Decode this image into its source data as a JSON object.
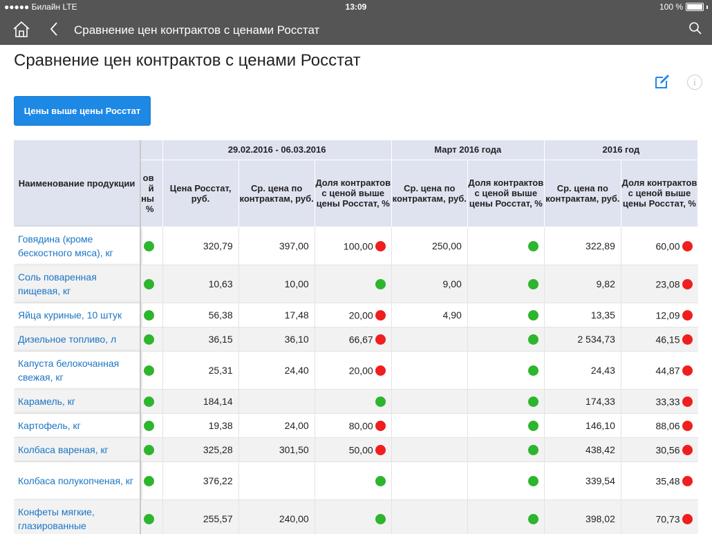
{
  "status": {
    "carrier": "●●●●● Билайн  LTE",
    "time": "13:09",
    "battery": "100 %"
  },
  "nav": {
    "title": "Сравнение цен контрактов с ценами Росстат"
  },
  "page": {
    "title": "Сравнение цен контрактов с ценами Росстат",
    "filter_button": "Цены выше цены Росстат"
  },
  "table": {
    "group_headers": [
      "29.02.2016 - 06.03.2016",
      "Март 2016 года",
      "2016 год"
    ],
    "name_header": "Наименование продукции",
    "cut_header_lines": [
      "ов",
      "й",
      "ны",
      "%"
    ],
    "col_headers": {
      "rosstat_price": "Цена Росстат, руб.",
      "avg_price": "Ср. цена по контрактам, руб.",
      "share": "Доля контрактов с ценой выше цены Росстат, %",
      "avg_price_march": "Ср. цена по контрактам, руб.",
      "share_march": "Доля контрактов с ценой выше цены Росстат, %",
      "avg_price_year": "Ср. цена по контрактам, руб.",
      "share_year": "Доля контрактов с ценой выше цены Росстат, %"
    },
    "rows": [
      {
        "name": "Говядина (кроме бескостного мяса), кг",
        "stub": "green",
        "rosstat": "320,79",
        "avg1": "397,00",
        "share1": "100,00",
        "share1_dot": "red",
        "avg2": "250,00",
        "share2": "",
        "share2_dot": "green",
        "avg3": "322,89",
        "share3": "60,00",
        "share3_dot": "red"
      },
      {
        "name": "Соль поваренная пищевая, кг",
        "stub": "green",
        "rosstat": "10,63",
        "avg1": "10,00",
        "share1": "",
        "share1_dot": "green",
        "avg2": "9,00",
        "share2": "",
        "share2_dot": "green",
        "avg3": "9,82",
        "share3": "23,08",
        "share3_dot": "red"
      },
      {
        "name": "Яйца куриные, 10 штук",
        "stub": "green",
        "rosstat": "56,38",
        "avg1": "17,48",
        "share1": "20,00",
        "share1_dot": "red",
        "avg2": "4,90",
        "share2": "",
        "share2_dot": "green",
        "avg3": "13,35",
        "share3": "12,09",
        "share3_dot": "red"
      },
      {
        "name": "Дизельное топливо, л",
        "stub": "green",
        "rosstat": "36,15",
        "avg1": "36,10",
        "share1": "66,67",
        "share1_dot": "red",
        "avg2": "",
        "share2": "",
        "share2_dot": "green",
        "avg3": "2 534,73",
        "share3": "46,15",
        "share3_dot": "red"
      },
      {
        "name": "Капуста белокочанная свежая, кг",
        "stub": "green",
        "rosstat": "25,31",
        "avg1": "24,40",
        "share1": "20,00",
        "share1_dot": "red",
        "avg2": "",
        "share2": "",
        "share2_dot": "green",
        "avg3": "24,43",
        "share3": "44,87",
        "share3_dot": "red"
      },
      {
        "name": "Карамель, кг",
        "stub": "green",
        "rosstat": "184,14",
        "avg1": "",
        "share1": "",
        "share1_dot": "green",
        "avg2": "",
        "share2": "",
        "share2_dot": "green",
        "avg3": "174,33",
        "share3": "33,33",
        "share3_dot": "red"
      },
      {
        "name": "Картофель, кг",
        "stub": "green",
        "rosstat": "19,38",
        "avg1": "24,00",
        "share1": "80,00",
        "share1_dot": "red",
        "avg2": "",
        "share2": "",
        "share2_dot": "green",
        "avg3": "146,10",
        "share3": "88,06",
        "share3_dot": "red"
      },
      {
        "name": "Колбаса вареная, кг",
        "stub": "green",
        "rosstat": "325,28",
        "avg1": "301,50",
        "share1": "50,00",
        "share1_dot": "red",
        "avg2": "",
        "share2": "",
        "share2_dot": "green",
        "avg3": "438,42",
        "share3": "30,56",
        "share3_dot": "red"
      },
      {
        "name": "Колбаса полукопченая, кг",
        "stub": "green",
        "rosstat": "376,22",
        "avg1": "",
        "share1": "",
        "share1_dot": "green",
        "avg2": "",
        "share2": "",
        "share2_dot": "green",
        "avg3": "339,54",
        "share3": "35,48",
        "share3_dot": "red"
      },
      {
        "name": "Конфеты мягкие, глазированные",
        "stub": "green",
        "rosstat": "255,57",
        "avg1": "240,00",
        "share1": "",
        "share1_dot": "green",
        "avg2": "",
        "share2": "",
        "share2_dot": "green",
        "avg3": "398,02",
        "share3": "70,73",
        "share3_dot": "red"
      }
    ]
  },
  "colors": {
    "accent": "#1e88e5",
    "header_bg": "#dfe3ef",
    "link": "#1b75c4",
    "green": "#2db52d",
    "red": "#f01e1e",
    "bar": "#555555"
  }
}
